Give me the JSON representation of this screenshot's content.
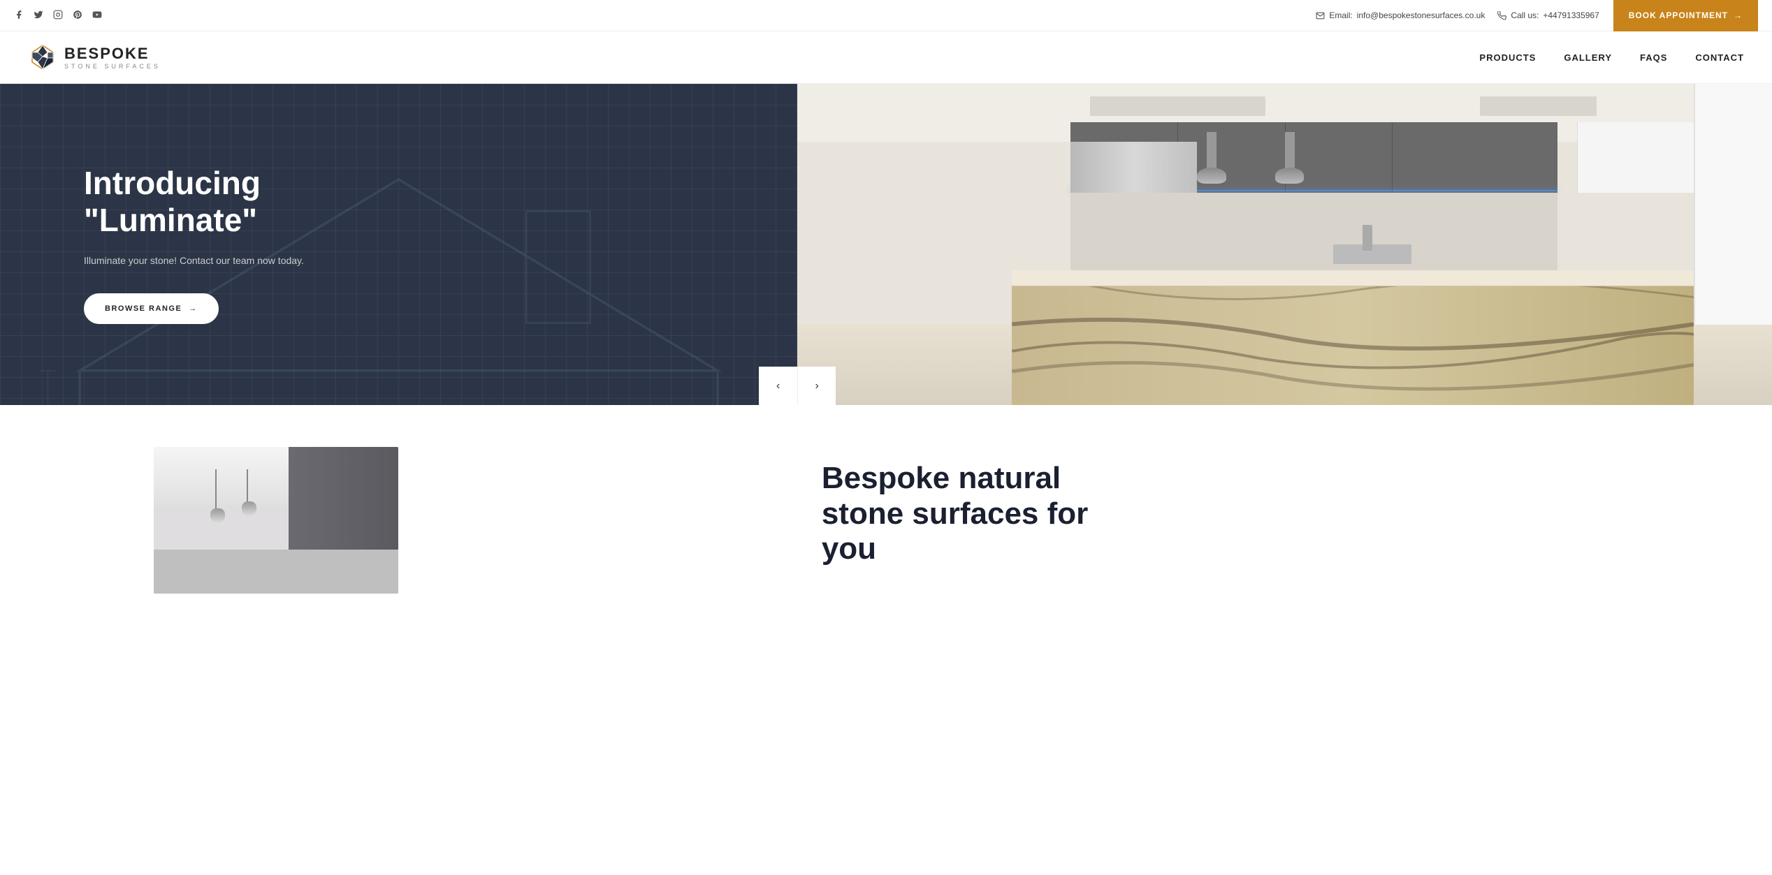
{
  "topbar": {
    "socials": [
      {
        "name": "facebook",
        "icon": "f"
      },
      {
        "name": "twitter",
        "icon": "t"
      },
      {
        "name": "instagram",
        "icon": "in"
      },
      {
        "name": "pinterest",
        "icon": "p"
      },
      {
        "name": "youtube",
        "icon": "y"
      }
    ],
    "email_label": "Email:",
    "email_value": "info@bespokestonesurfaces.co.uk",
    "phone_label": "Call us:",
    "phone_value": "+44791335967",
    "book_label": "BOOK APPOINTMENT",
    "book_arrow": "→"
  },
  "nav": {
    "logo_brand": "BESPOKE",
    "logo_sub": "STONE SURFACES",
    "links": [
      {
        "label": "PRODUCTS"
      },
      {
        "label": "GALLERY"
      },
      {
        "label": "FAQS"
      },
      {
        "label": "CONTACT"
      }
    ]
  },
  "hero": {
    "title_line1": "Introducing",
    "title_line2": "\"Luminate\"",
    "description": "Illuminate your stone! Contact our team now today.",
    "browse_label": "BROWSE RANGE",
    "browse_arrow": "→"
  },
  "below": {
    "section_title_line1": "Bespoke natural",
    "section_title_line2": "stone surfaces for",
    "section_title_line3": "you"
  },
  "slider": {
    "prev_arrow": "‹",
    "next_arrow": "›"
  }
}
